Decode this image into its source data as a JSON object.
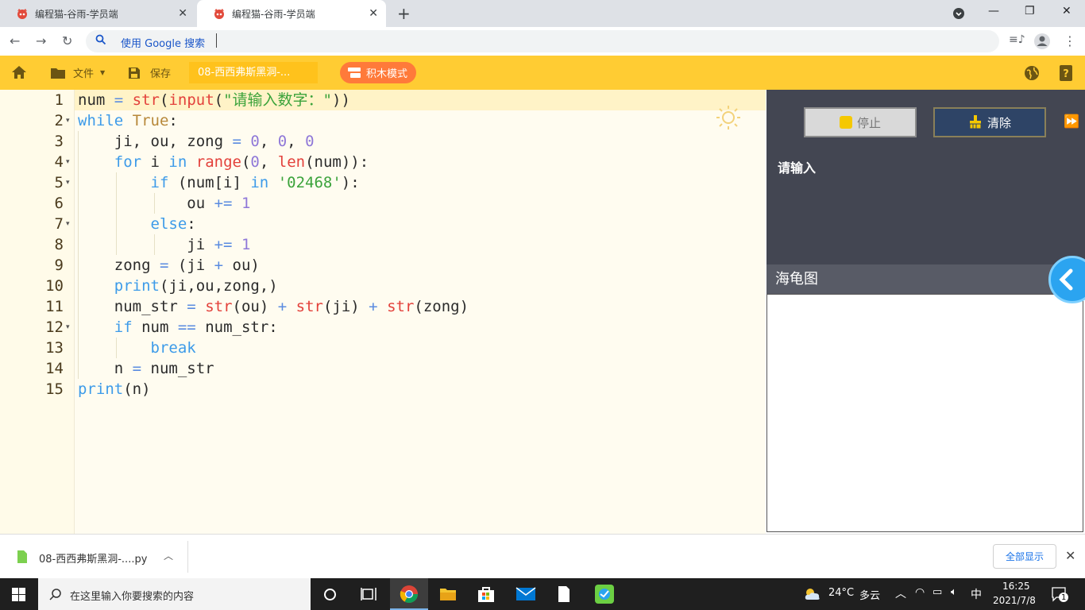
{
  "browser": {
    "tabs": [
      {
        "title": "编程猫-谷雨-学员端"
      },
      {
        "title": "编程猫-谷雨-学员端"
      }
    ],
    "omnibox_placeholder": "使用 Google 搜索"
  },
  "toolbar": {
    "file_label": "文件",
    "save_label": "保存",
    "filename": "08-西西弗斯黑洞-...",
    "block_mode_label": "积木模式"
  },
  "editor": {
    "line_numbers": [
      "1",
      "2",
      "3",
      "4",
      "5",
      "6",
      "7",
      "8",
      "9",
      "10",
      "11",
      "12",
      "13",
      "14",
      "15"
    ],
    "lines": [
      "num = str(input(\"请输入数字：\"))",
      "while True:",
      "    ji, ou, zong = 0, 0, 0",
      "    for i in range(0, len(num)):",
      "        if (num[i] in '02468'):",
      "            ou += 1",
      "        else:",
      "            ji += 1",
      "    zong = (ji + ou)",
      "    print(ji,ou,zong,)",
      "    num_str = str(ou) + str(ji) + str(zong)",
      "    if num == num_str:",
      "        break",
      "    n = num_str",
      "print(n)"
    ]
  },
  "console": {
    "stop_label": "停止",
    "clear_label": "清除",
    "output": "请输入"
  },
  "turtle": {
    "header": "海龟图"
  },
  "downloads": {
    "file": "08-西西弗斯黑洞-....py",
    "show_all": "全部显示"
  },
  "taskbar": {
    "search_placeholder": "在这里输入你要搜索的内容",
    "weather_temp": "24°C",
    "weather_text": "多云",
    "ime": "中",
    "time": "16:25",
    "date": "2021/7/8",
    "notification_count": "1"
  },
  "colors": {
    "toolbar": "#ffcc33",
    "editor_bg": "#fffcf0",
    "console_bg": "#434652",
    "keyword": "#3d9be9",
    "builtin": "#e3413b",
    "number": "#8f78d8",
    "string": "#3ba33b"
  }
}
